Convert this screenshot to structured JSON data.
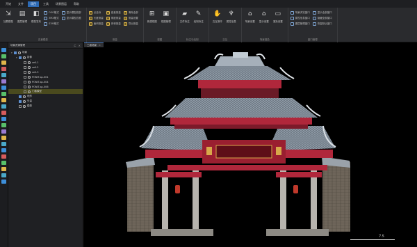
{
  "menu": [
    "开始",
    "文件",
    "项目",
    "工具",
    "场景图层",
    "帮助"
  ],
  "active_menu_index": 2,
  "ribbon": {
    "groups": [
      {
        "label": "实景模型",
        "big": [
          {
            "label": "加载模型",
            "icon": "import-icon",
            "glyph": "⇲"
          },
          {
            "label": "图层管理",
            "icon": "layers-icon",
            "glyph": "▤"
          },
          {
            "label": "模型发布",
            "icon": "publish-icon",
            "glyph": "◧"
          }
        ],
        "small_cols": [
          [
            {
              "label": "OSG格式",
              "icon": "osg-icon"
            },
            {
              "label": "3MX格式",
              "icon": "3mx-icon"
            },
            {
              "label": "S3M格式",
              "icon": "s3m-icon"
            }
          ],
          [
            {
              "label": "显示模型底部",
              "icon": "bottom-icon"
            },
            {
              "label": "显示模型边框",
              "icon": "border-icon"
            },
            {
              "label": "",
              "icon": ""
            }
          ]
        ]
      },
      {
        "label": "测量",
        "small_cols": [
          [
            {
              "label": "点坐标",
              "icon": "point-icon"
            },
            {
              "label": "长度测量",
              "icon": "length-icon"
            },
            {
              "label": "面积测量",
              "icon": "area-icon"
            }
          ],
          [
            {
              "label": "高差测量",
              "icon": "height-icon"
            },
            {
              "label": "角度测量",
              "icon": "angle-icon"
            },
            {
              "label": "体积测量",
              "icon": "volume-icon"
            }
          ],
          [
            {
              "label": "清除全部",
              "icon": "clear-icon"
            },
            {
              "label": "测量设置",
              "icon": "settings-icon"
            },
            {
              "label": "导出测量",
              "icon": "export-icon"
            }
          ]
        ]
      },
      {
        "label": "视图",
        "big": [
          {
            "label": "新建视图",
            "icon": "new-view-icon",
            "glyph": "⊞"
          },
          {
            "label": "视图管理",
            "icon": "view-manage-icon",
            "glyph": "▣"
          }
        ]
      },
      {
        "label": "标注与绘制",
        "big": [
          {
            "label": "文件标注",
            "icon": "folder-icon",
            "glyph": "▰"
          },
          {
            "label": "绘制标注",
            "icon": "draw-icon",
            "glyph": "✎"
          }
        ]
      },
      {
        "label": "交互",
        "big": [
          {
            "label": "交互操作",
            "icon": "hand-icon",
            "glyph": "✋"
          },
          {
            "label": "属性信息",
            "icon": "info-icon",
            "glyph": "♆"
          }
        ]
      },
      {
        "label": "场景渲染",
        "big": [
          {
            "label": "场景设置",
            "icon": "scene-icon",
            "glyph": "⌂"
          },
          {
            "label": "显示设置",
            "icon": "display-icon",
            "glyph": "⌂"
          },
          {
            "label": "渲染设置",
            "icon": "render-icon",
            "glyph": "▭"
          }
        ]
      },
      {
        "label": "窗口管理",
        "small_cols": [
          [
            {
              "label": "场景浏览窗口",
              "icon": "window-icon"
            },
            {
              "label": "属性信息窗口",
              "icon": "window-icon"
            },
            {
              "label": "图层管理窗口",
              "icon": "window-icon"
            }
          ],
          [
            {
              "label": "显示全部窗口",
              "icon": "window-icon"
            },
            {
              "label": "隐藏全部窗口",
              "icon": "window-icon"
            },
            {
              "label": "恢复默认窗口",
              "icon": "window-icon"
            }
          ]
        ]
      }
    ]
  },
  "left_tools": [
    "#3d8fd9",
    "#58c06a",
    "#e0b64a",
    "#d65c5c",
    "#4aa9c9",
    "#9a7bd1",
    "#3d8fd9",
    "#58c06a",
    "#e0b64a",
    "#4aa9c9",
    "#d65c5c",
    "#3d8fd9",
    "#58c06a",
    "#9a7bd1",
    "#e0b64a",
    "#4aa9c9",
    "#3d8fd9",
    "#d65c5c",
    "#58c06a",
    "#e0b64a",
    "#4aa9c9",
    "#3d8fd9"
  ],
  "tree_panel": {
    "title": "场景资源管理",
    "ctrl_pin": "⊏",
    "ctrl_close": "×",
    "rows": [
      {
        "indent": 0,
        "arrow": "▾",
        "check": true,
        "label": "场景"
      },
      {
        "indent": 1,
        "arrow": "▾",
        "check": true,
        "label": "影像"
      },
      {
        "indent": 2,
        "arrow": "",
        "check": false,
        "label": "cell-1"
      },
      {
        "indent": 2,
        "arrow": "",
        "check": false,
        "label": "cell-2"
      },
      {
        "indent": 2,
        "arrow": "",
        "check": false,
        "label": "cell-3"
      },
      {
        "indent": 2,
        "arrow": "",
        "check": false,
        "label": "PONIT-sp-001"
      },
      {
        "indent": 2,
        "arrow": "",
        "check": false,
        "label": "PONIT-sp-004"
      },
      {
        "indent": 2,
        "arrow": "",
        "check": false,
        "label": "PONIT-sp-006"
      },
      {
        "indent": 2,
        "arrow": "",
        "check": false,
        "label": "门楼模型"
      },
      {
        "indent": 1,
        "arrow": "",
        "check": true,
        "label": "地形"
      },
      {
        "indent": 1,
        "arrow": "",
        "check": true,
        "label": "矢量"
      },
      {
        "indent": 1,
        "arrow": "",
        "check": false,
        "label": "模型"
      }
    ],
    "selected_index": 8
  },
  "viewport": {
    "tab_label": "三维场景",
    "tab_close": "×",
    "scale_label": "7.5"
  }
}
